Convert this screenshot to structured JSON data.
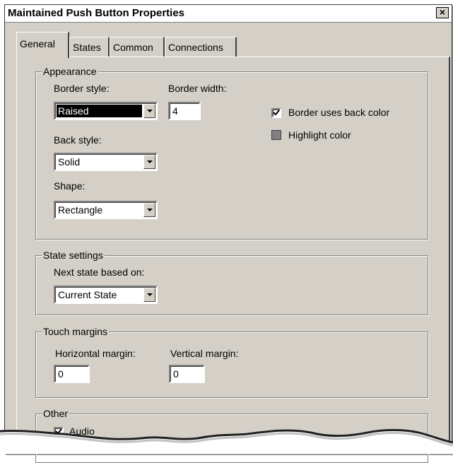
{
  "window": {
    "title": "Maintained Push Button Properties",
    "close": "×"
  },
  "tabs": [
    {
      "label": "General",
      "active": true
    },
    {
      "label": "States"
    },
    {
      "label": "Common"
    },
    {
      "label": "Connections"
    }
  ],
  "appearance": {
    "legend": "Appearance",
    "border_style_label": "Border style:",
    "border_style_value": "Raised",
    "border_width_label": "Border width:",
    "border_width_value": "4",
    "border_uses_back_color_label": "Border uses back color",
    "border_uses_back_color_checked": true,
    "highlight_color_label": "Highlight color",
    "highlight_color": "#808080",
    "back_style_label": "Back style:",
    "back_style_value": "Solid",
    "shape_label": "Shape:",
    "shape_value": "Rectangle"
  },
  "state_settings": {
    "legend": "State settings",
    "next_state_label": "Next state based on:",
    "next_state_value": "Current State"
  },
  "touch_margins": {
    "legend": "Touch margins",
    "horizontal_label": "Horizontal  margin:",
    "horizontal_value": "0",
    "vertical_label": "Vertical margin:",
    "vertical_value": "0"
  },
  "other": {
    "legend": "Other",
    "audio_label": "Audio",
    "audio_checked": true
  }
}
